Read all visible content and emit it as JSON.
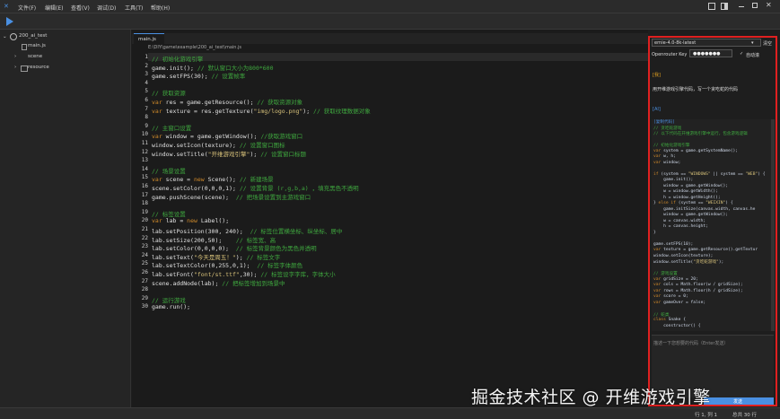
{
  "menubar": {
    "items": [
      "文件(F)",
      "编辑(E)",
      "查看(V)",
      "调试(D)",
      "工具(T)",
      "帮助(H)"
    ]
  },
  "tab": {
    "label": "main.js"
  },
  "path": {
    "text": "E:\\DIY\\game\\example\\200_ai_test\\main.js"
  },
  "sidebar": {
    "project": "200_ai_test",
    "items": [
      {
        "label": "main.js"
      },
      {
        "label": "scene"
      },
      {
        "label": "resource"
      }
    ]
  },
  "code": {
    "lines": [
      "// 初始化游戏引擎",
      "game.init(); // 默认窗口大小为800*600",
      "game.setFPS(30); // 设置帧率",
      "",
      "// 获取资源",
      "var res = game.getResource(); // 获取资源对象",
      "var texture = res.getTexture(\"img/logo.png\"); // 获取纹理数据对象",
      "",
      "// 主窗口设置",
      "var window = game.getWindow(); //获取游戏窗口",
      "window.setIcon(texture); // 设置窗口图标",
      "window.setTitle(\"开维游戏引擎\"); // 设置窗口标题",
      "",
      "// 场景设置",
      "var scene = new Scene(); // 新建场景",
      "scene.setColor(0,0,0,1); // 设置背景 (r,g,b,a) ，填充黑色不透明",
      "game.pushScene(scene);  // 把场景设置到主游戏窗口",
      "",
      "// 标签设置",
      "var lab = new Label();",
      "lab.setPosition(300, 240);  // 标签位置横坐标、纵坐标、居中",
      "lab.setSize(200,50);    // 标签宽、高",
      "lab.setColor(0,0,0,0);  // 标签背景颜色为黑色并透明",
      "lab.setText(\"今天是周五！\"); // 标签文字",
      "lab.setTextColor(0,255,0,1);  // 标签字体颜色",
      "lab.setFont(\"font/st.ttf\",30); // 标签设字字库，字体大小",
      "scene.addNode(lab); // 把标签增加到场景中",
      "",
      "// 运行游戏",
      "game.run();"
    ]
  },
  "ai": {
    "model": "ernie-4.0-8k-latest",
    "clear_label": "清空",
    "key_label": "Openrouter Key",
    "key_value": "●●●●●●●",
    "autoscroll_label": "自动滚",
    "user_tag": "[我]",
    "user_msg": "用开维游戏引擎代码，写一个贪吃蛇的代码",
    "ai_tag": "[AI]",
    "reply_lines": [
      "[复制代码]",
      "// 贪吃蛇游戏",
      "// 以下代码在开维游戏引擎中运行，包含游戏逻辑",
      "",
      "// 初始化游戏引擎",
      "var system = game.getSystemName();",
      "var w, h;",
      "var window;",
      "",
      "if (system == \"WINDOWS\" || system == \"WEB\") {",
      "    game.init();",
      "    window = game.getWindow();",
      "    w = window.getWidth();",
      "    h = window.getHeight();",
      "} else if (system == \"WEIXIN\") {",
      "    game.initSize(canvas.width, canvas.he",
      "    window = game.getWindow();",
      "    w = canvas.width;",
      "    h = canvas.height;",
      "}",
      "",
      "game.setFPS(10);",
      "var texture = game.getResource().getTextur",
      "window.setIcon(texture);",
      "window.setTitle(\"贪吃蛇游戏\");",
      "",
      "// 游戏设置",
      "var gridSize = 20;",
      "var cols = Math.floor(w / gridSize);",
      "var rows = Math.floor(h / gridSize);",
      "var score = 0;",
      "var gameOver = false;",
      "",
      "// 蛇类",
      "class Snake {",
      "    constructor() {"
    ],
    "input_placeholder": "描述一下您想要的代码（Enter发送）",
    "send_label": "发送"
  },
  "status": {
    "line_col": "行 1, 列 1",
    "total": "总共 30 行"
  },
  "watermark": "掘金技术社区 @ 开维游戏引擎",
  "colors": {
    "accent": "#4a90e2",
    "panel_border": "#e02020",
    "comment": "#3fa83f",
    "keyword": "#d08a2a",
    "string": "#d8c27a"
  }
}
